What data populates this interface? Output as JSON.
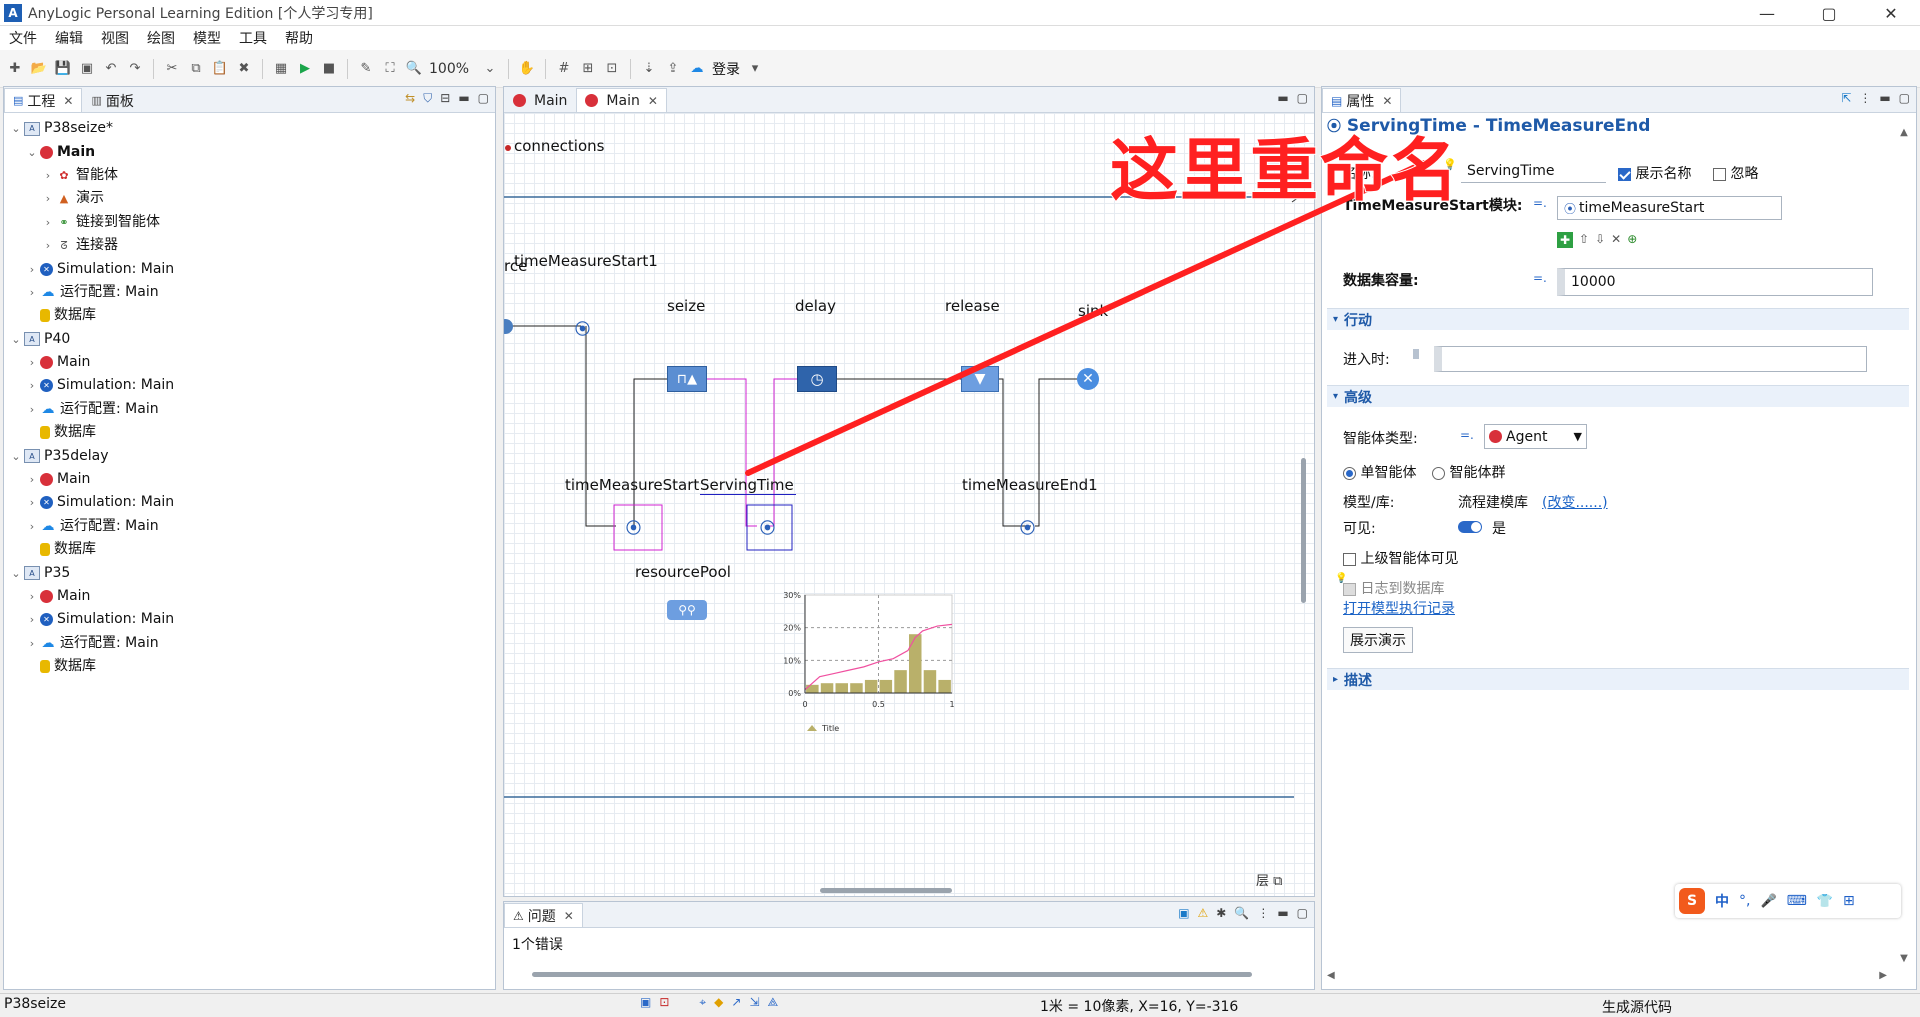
{
  "window": {
    "title": "AnyLogic Personal Learning Edition [个人学习专用]",
    "app_icon": "anylogic-logo-icon",
    "minimize": "—",
    "maximize": "▢",
    "close": "✕"
  },
  "menu": [
    "文件",
    "编辑",
    "视图",
    "绘图",
    "模型",
    "工具",
    "帮助"
  ],
  "toolbar": {
    "zoom": "100%",
    "login": "登录"
  },
  "left_panel": {
    "tabs": [
      "工程",
      "面板"
    ],
    "tree": [
      {
        "label": "P38seize*",
        "level": 0,
        "icon": "project-icon",
        "bold": false
      },
      {
        "label": "Main",
        "level": 1,
        "icon": "agent-red-icon",
        "bold": true
      },
      {
        "label": "智能体",
        "level": 2,
        "icon": "agents-icon",
        "bold": false
      },
      {
        "label": "演示",
        "level": 2,
        "icon": "presentation-icon",
        "bold": false
      },
      {
        "label": "链接到智能体",
        "level": 2,
        "icon": "link-icon",
        "bold": false
      },
      {
        "label": "连接器",
        "level": 2,
        "icon": "connector-icon",
        "bold": false
      },
      {
        "label": "Simulation: Main",
        "level": 1,
        "icon": "simulation-icon",
        "bold": false
      },
      {
        "label": "运行配置: Main",
        "level": 1,
        "icon": "cloud-icon",
        "bold": false
      },
      {
        "label": "数据库",
        "level": 1,
        "icon": "database-icon",
        "bold": false
      },
      {
        "label": "P40",
        "level": 0,
        "icon": "project-icon",
        "bold": false
      },
      {
        "label": "Main",
        "level": 1,
        "icon": "agent-red-icon",
        "bold": false
      },
      {
        "label": "Simulation: Main",
        "level": 1,
        "icon": "simulation-icon",
        "bold": false
      },
      {
        "label": "运行配置: Main",
        "level": 1,
        "icon": "cloud-icon",
        "bold": false
      },
      {
        "label": "数据库",
        "level": 1,
        "icon": "database-icon",
        "bold": false
      },
      {
        "label": "P35delay",
        "level": 0,
        "icon": "project-icon",
        "bold": false
      },
      {
        "label": "Main",
        "level": 1,
        "icon": "agent-red-icon",
        "bold": false
      },
      {
        "label": "Simulation: Main",
        "level": 1,
        "icon": "simulation-icon",
        "bold": false
      },
      {
        "label": "运行配置: Main",
        "level": 1,
        "icon": "cloud-icon",
        "bold": false
      },
      {
        "label": "数据库",
        "level": 1,
        "icon": "database-icon",
        "bold": false
      },
      {
        "label": "P35",
        "level": 0,
        "icon": "project-icon",
        "bold": false
      },
      {
        "label": "Main",
        "level": 1,
        "icon": "agent-red-icon",
        "bold": false
      },
      {
        "label": "Simulation: Main",
        "level": 1,
        "icon": "simulation-icon",
        "bold": false
      },
      {
        "label": "运行配置: Main",
        "level": 1,
        "icon": "cloud-icon",
        "bold": false
      },
      {
        "label": "数据库",
        "level": 1,
        "icon": "database-icon",
        "bold": false
      }
    ]
  },
  "editor": {
    "tabs": [
      "Main",
      "Main"
    ],
    "labels": {
      "connections": "connections",
      "source_partial": "rce",
      "timeMeasureStart1": "timeMeasureStart1",
      "seize": "seize",
      "delay": "delay",
      "release": "release",
      "sink": "sink",
      "timeMeasureStart": "timeMeasureStart",
      "servingTime": "ServingTime",
      "timeMeasureEnd1": "timeMeasureEnd1",
      "resourcePool": "resourcePool",
      "layers": "层"
    }
  },
  "chart_data": {
    "type": "bar",
    "x_ticks": [
      "0",
      "0.5",
      "1"
    ],
    "y_ticks": [
      "0%",
      "10%",
      "20%",
      "30%"
    ],
    "ylim": [
      0,
      30
    ],
    "xlim": [
      0,
      1
    ],
    "series": [
      {
        "name": "Title",
        "type": "bar",
        "color": "#b9b06a",
        "x": [
          0.05,
          0.15,
          0.25,
          0.35,
          0.45,
          0.55,
          0.65,
          0.75,
          0.85,
          0.95
        ],
        "values": [
          2.5,
          3,
          3,
          3,
          4,
          4,
          7,
          18,
          7,
          4
        ]
      },
      {
        "type": "line",
        "color": "#f050a0",
        "x": [
          0,
          0.1,
          0.2,
          0.3,
          0.4,
          0.5,
          0.6,
          0.7,
          0.75,
          0.8,
          0.9,
          1
        ],
        "values": [
          1,
          5,
          6,
          7,
          8,
          9.5,
          10.5,
          13,
          17,
          19,
          20.5,
          21
        ]
      }
    ],
    "legend": "bottom-left"
  },
  "annotation": {
    "text": "这里重命名",
    "color": "#ff2020"
  },
  "properties": {
    "tab": "属性",
    "header": "ServingTime - TimeMeasureEnd",
    "name_label": "名称:",
    "name_value": "ServingTime",
    "show_name": "展示名称",
    "ignore": "忽略",
    "start_module_label": "TimeMeasureStart模块:",
    "start_module_value": "timeMeasureStart",
    "dataset_label": "数据集容量:",
    "dataset_value": "10000",
    "section_action": "行动",
    "on_enter_label": "进入时:",
    "section_advanced": "高级",
    "agent_type_label": "智能体类型:",
    "agent_type_value": "Agent",
    "single_agent": "单智能体",
    "population": "智能体群",
    "model_lib_label": "模型/库:",
    "model_lib_value": "流程建模库",
    "change_link": "(改变......)",
    "visible_label": "可见:",
    "visible_value": "是",
    "upper_visible": "上级智能体可见",
    "log_db": "日志到数据库",
    "open_log": "打开模型执行记录",
    "show_demo": "展示演示",
    "section_desc": "描述"
  },
  "problems": {
    "tab": "问题",
    "text": "1个错误"
  },
  "ime": {
    "items": [
      "中",
      "°,",
      "🎤",
      "⌨",
      "👕",
      "⊞"
    ]
  },
  "status": {
    "project": "P38seize",
    "coords": "1米 = 10像素, X=16, Y=-316",
    "codegen": "生成源代码"
  }
}
